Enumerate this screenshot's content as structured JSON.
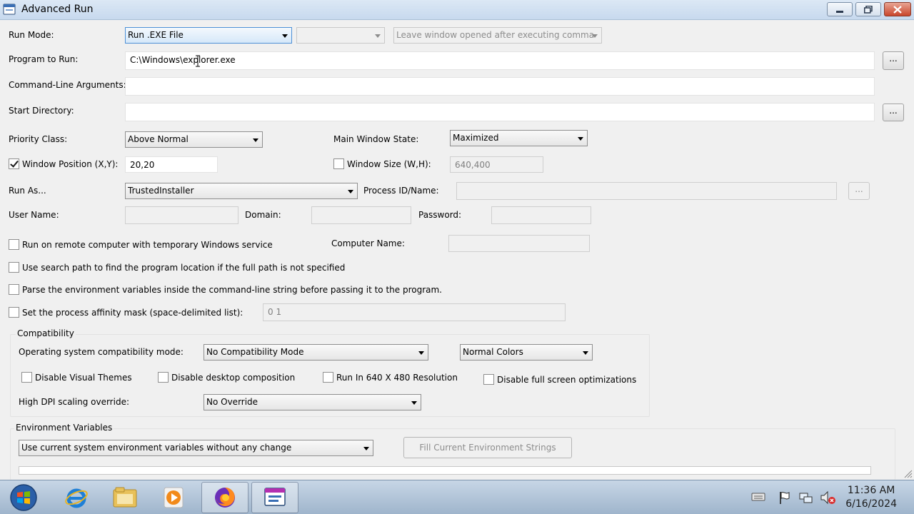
{
  "window": {
    "title": "Advanced Run"
  },
  "run_mode": {
    "label": "Run Mode:",
    "value": "Run .EXE File",
    "second_value": "",
    "window_option": "Leave window opened after executing comma"
  },
  "program": {
    "label": "Program to Run:",
    "value": "C:\\Windows\\explorer.exe",
    "browse": "..."
  },
  "args": {
    "label": "Command-Line Arguments:",
    "value": ""
  },
  "start_dir": {
    "label": "Start Directory:",
    "value": "",
    "browse": "..."
  },
  "priority": {
    "label": "Priority Class:",
    "value": "Above Normal"
  },
  "main_window_state": {
    "label": "Main Window State:",
    "value": "Maximized"
  },
  "window_position": {
    "label": "Window Position (X,Y):",
    "value": "20,20",
    "checked": true
  },
  "window_size": {
    "label": "Window Size (W,H):",
    "value": "640,400",
    "checked": false
  },
  "run_as": {
    "label": "Run As...",
    "value": "TrustedInstaller"
  },
  "process_id": {
    "label": "Process ID/Name:",
    "value": "",
    "browse": "..."
  },
  "credentials": {
    "user_label": "User Name:",
    "domain_label": "Domain:",
    "password_label": "Password:"
  },
  "remote": {
    "label": "Run on remote computer with temporary Windows service",
    "computer_label": "Computer Name:"
  },
  "search_path": {
    "label": "Use search path to find the program location if the full path is not specified"
  },
  "parse_env": {
    "label": "Parse the environment variables inside the command-line string before passing it to the program."
  },
  "affinity": {
    "label": "Set the process affinity mask (space-delimited list):",
    "value": "0 1"
  },
  "compat": {
    "title": "Compatibility",
    "os_label": "Operating system compatibility mode:",
    "os_value": "No Compatibility Mode",
    "colors_value": "Normal Colors",
    "disable_visual_themes": "Disable Visual Themes",
    "disable_desktop_composition": "Disable desktop composition",
    "run_640": "Run In 640 X 480 Resolution",
    "disable_fullscreen_opt": "Disable full screen optimizations",
    "dpi_label": "High DPI scaling override:",
    "dpi_value": "No Override"
  },
  "env": {
    "title": "Environment Variables",
    "value": "Use current system environment variables without any change",
    "fill_button": "Fill Current Environment Strings"
  },
  "taskbar": {
    "apps": [
      "start-orb",
      "internet-explorer",
      "file-explorer",
      "media-player",
      "firefox",
      "advanced-run"
    ],
    "active_app": "advanced-run",
    "time": "11:36 AM",
    "date": "6/16/2024"
  },
  "colors": {
    "titlebar": "#c7d9ee",
    "taskbar": "#9fb5cc",
    "accent": "#4d90d6"
  }
}
